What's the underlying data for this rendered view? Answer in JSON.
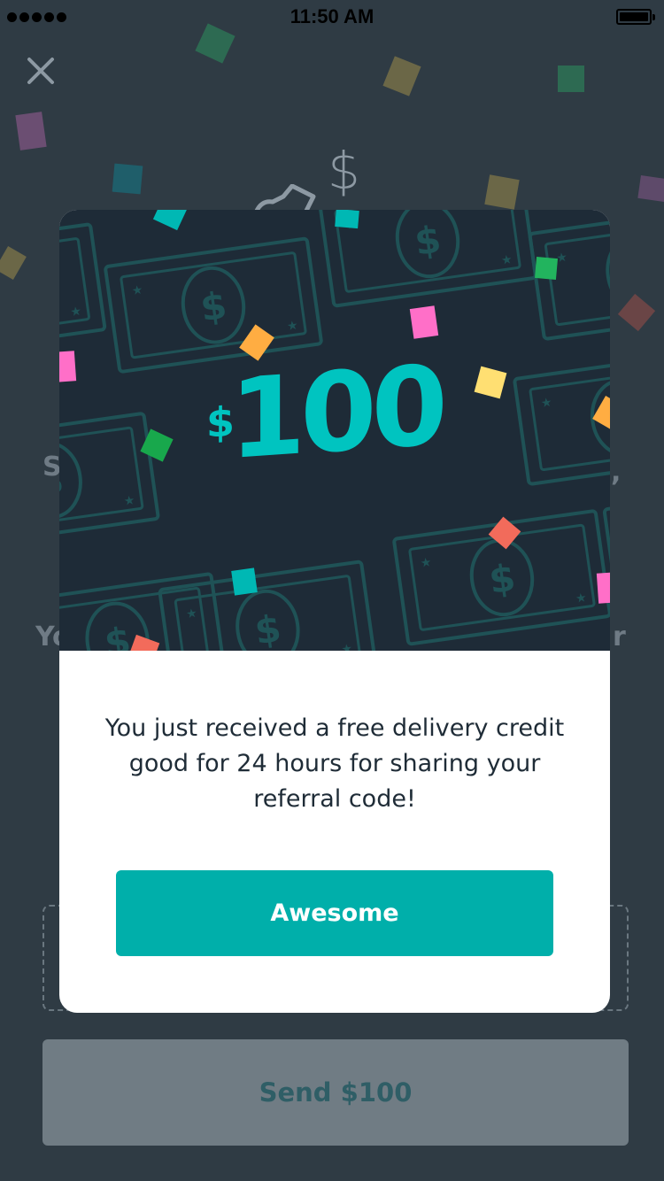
{
  "status_bar": {
    "time": "11:50 AM"
  },
  "background_screen": {
    "peek_left_1": "S",
    "peek_right_1": ",",
    "peek_left_2": "Yo",
    "peek_right_2": "r",
    "send_button_label": "Send $100"
  },
  "modal": {
    "currency_symbol": "$",
    "amount": "100",
    "message": "You just received a free delivery credit good for 24 hours for sharing your referral code!",
    "button_label": "Awesome"
  },
  "colors": {
    "accent": "#00afaa",
    "amount": "#00c4c0",
    "hero_background": "#1e2b37",
    "screen_background": "#2f3b44"
  }
}
